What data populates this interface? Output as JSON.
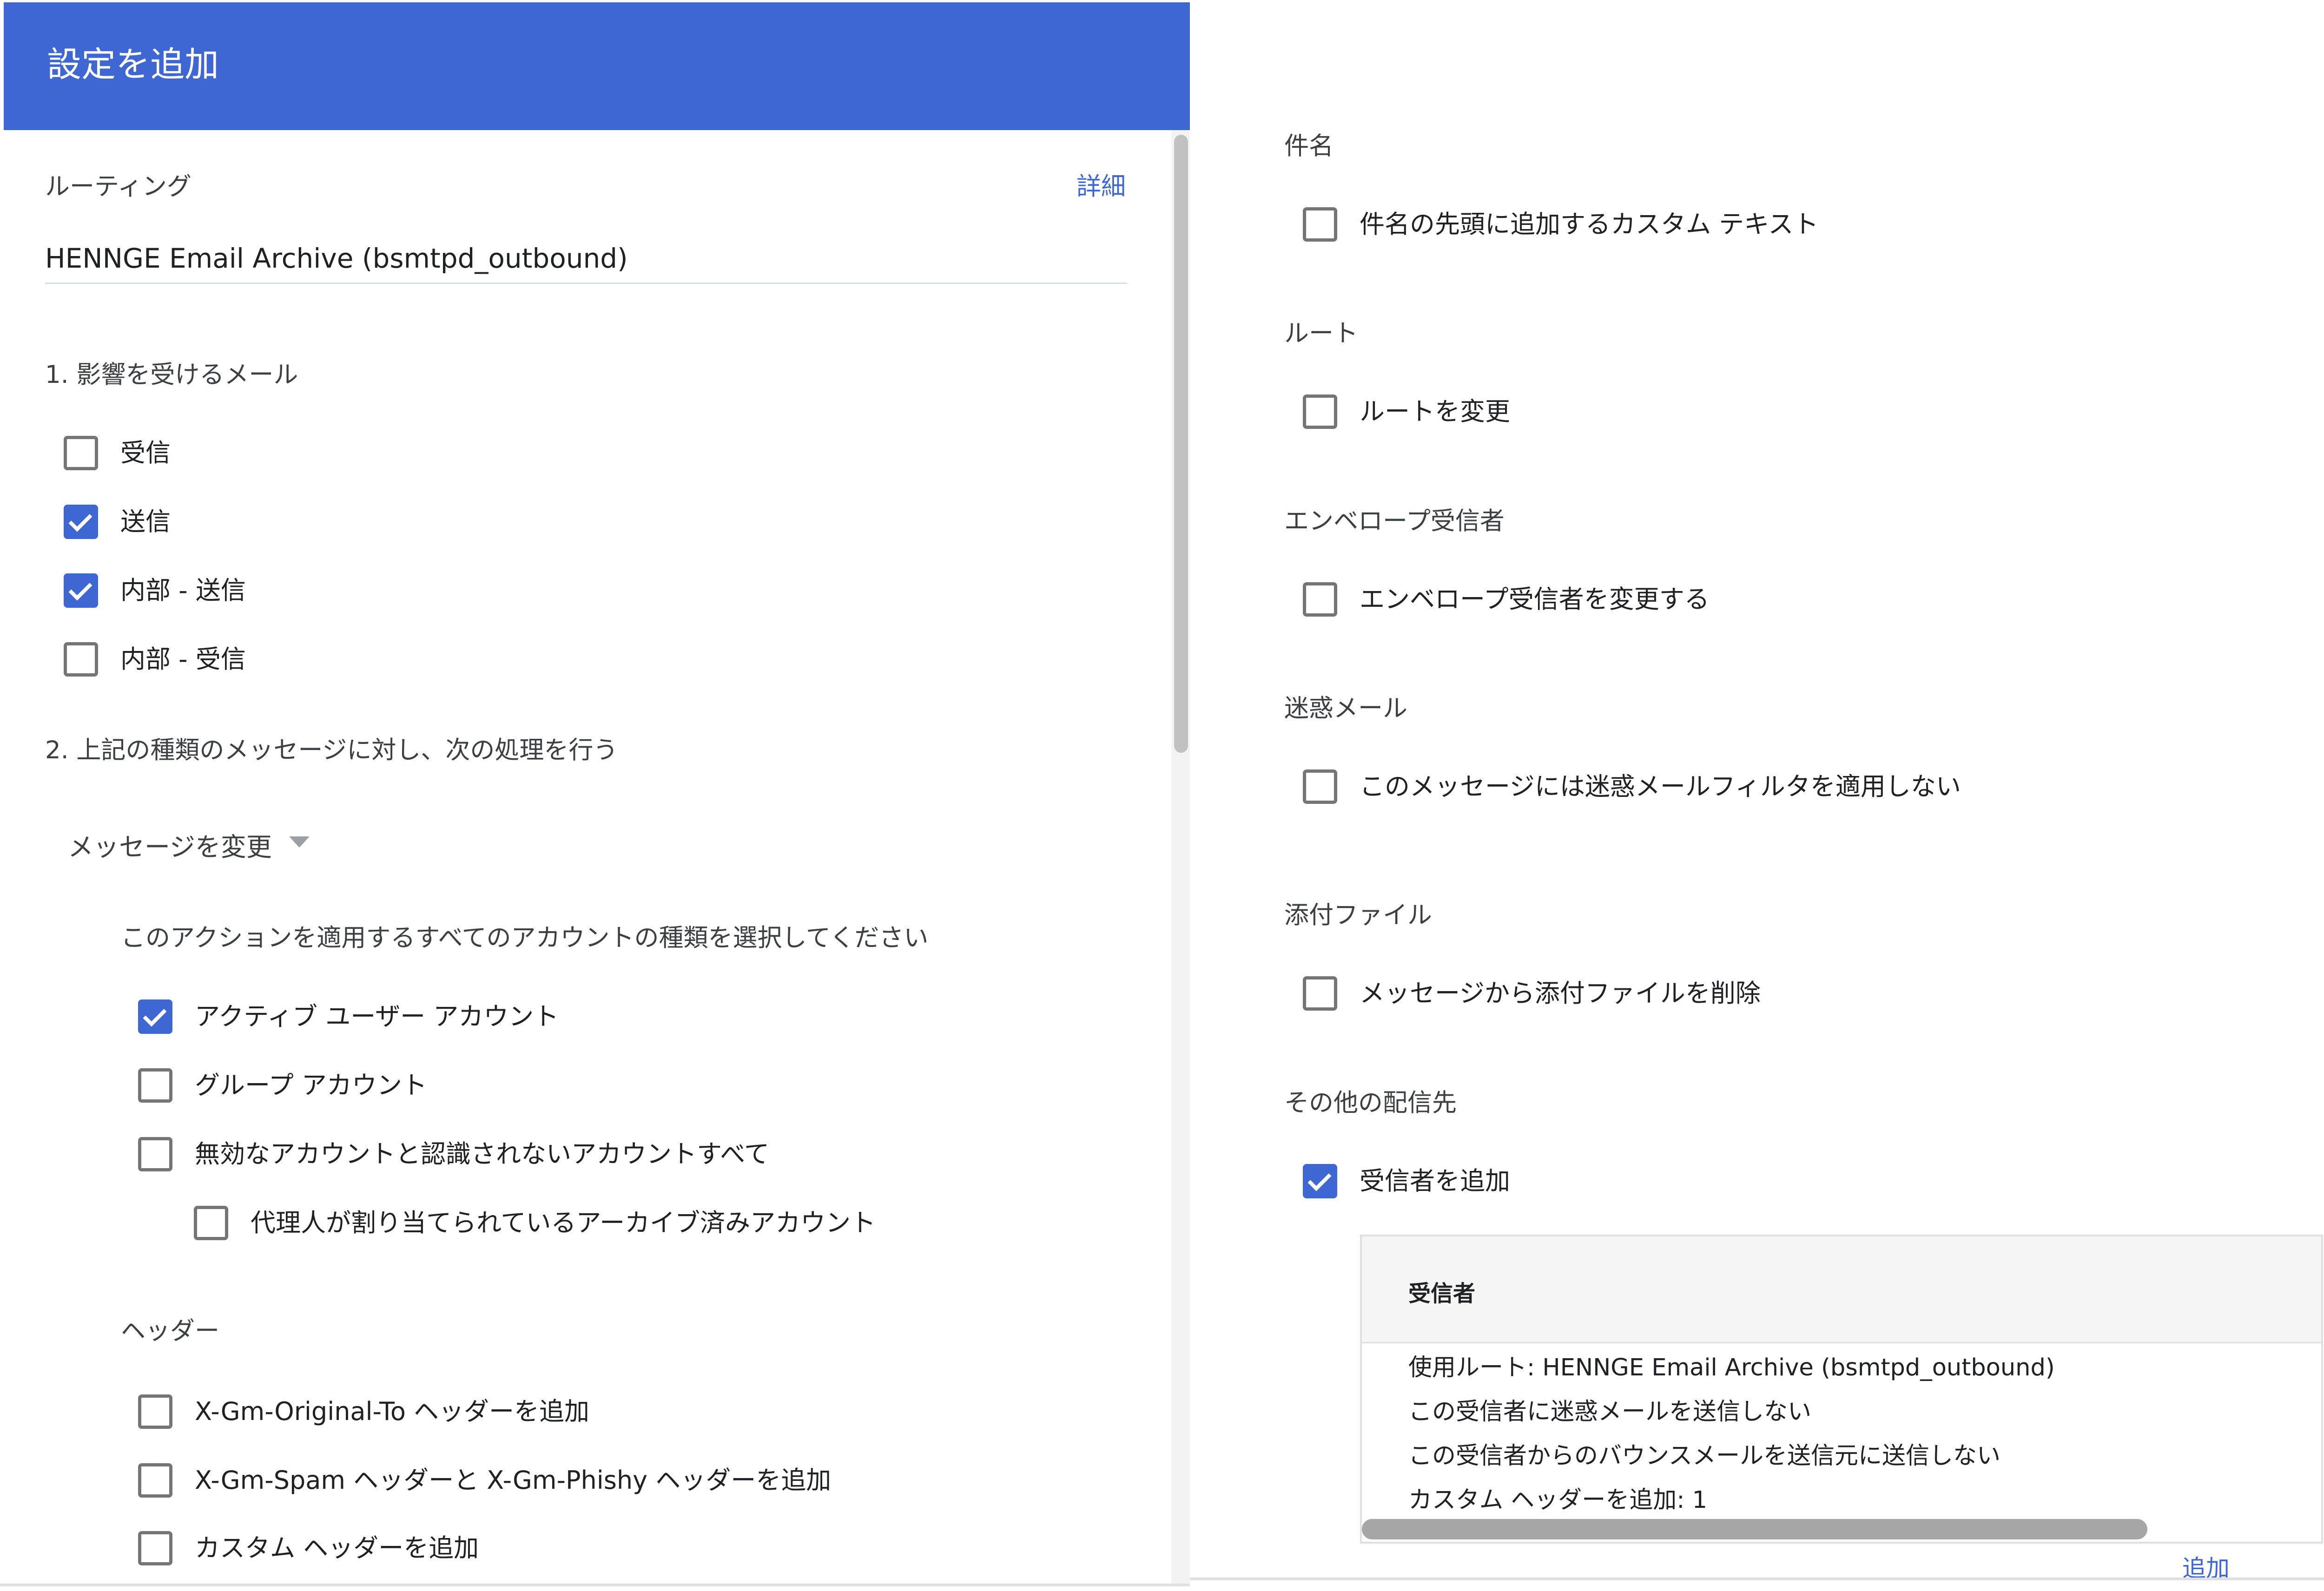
{
  "dialog": {
    "title": "設定を追加"
  },
  "routing": {
    "label": "ルーティング",
    "details_link": "詳細",
    "value": "HENNGE Email Archive (bsmtpd_outbound)"
  },
  "section1": {
    "heading": "1. 影響を受けるメール",
    "options": [
      {
        "label": "受信",
        "checked": false
      },
      {
        "label": "送信",
        "checked": true
      },
      {
        "label": "内部 - 送信",
        "checked": true
      },
      {
        "label": "内部 - 受信",
        "checked": false
      }
    ]
  },
  "section2": {
    "heading": "2. 上記の種類のメッセージに対し、次の処理を行う",
    "action_dropdown": "メッセージを変更",
    "account_types_prompt": "このアクションを適用するすべてのアカウントの種類を選択してください",
    "account_types": [
      {
        "label": "アクティブ ユーザー アカウント",
        "checked": true
      },
      {
        "label": "グループ アカウント",
        "checked": false
      },
      {
        "label": "無効なアカウントと認識されないアカウントすべて",
        "checked": false
      },
      {
        "label": "代理人が割り当てられているアーカイブ済みアカウント",
        "checked": false
      }
    ],
    "headers_heading": "ヘッダー",
    "headers_options": [
      {
        "label": "X-Gm-Original-To ヘッダーを追加",
        "checked": false
      },
      {
        "label": "X-Gm-Spam ヘッダーと X-Gm-Phishy ヘッダーを追加",
        "checked": false
      },
      {
        "label": "カスタム ヘッダーを追加",
        "checked": false
      }
    ]
  },
  "right": {
    "subject": {
      "heading": "件名",
      "option": "件名の先頭に追加するカスタム テキスト",
      "checked": false
    },
    "route": {
      "heading": "ルート",
      "option": "ルートを変更",
      "checked": false
    },
    "envelope": {
      "heading": "エンベロープ受信者",
      "option": "エンベロープ受信者を変更する",
      "checked": false
    },
    "spam": {
      "heading": "迷惑メール",
      "option": "このメッセージには迷惑メールフィルタを適用しない",
      "checked": false
    },
    "attachments": {
      "heading": "添付ファイル",
      "option": "メッセージから添付ファイルを削除",
      "checked": false
    },
    "other_destinations": {
      "heading": "その他の配信先",
      "option": "受信者を追加",
      "checked": true
    },
    "recipients_table": {
      "header": "受信者",
      "lines": [
        "使用ルート: HENNGE Email Archive (bsmtpd_outbound)",
        "この受信者に迷惑メールを送信しない",
        "この受信者からのバウンスメールを送信元に送信しない",
        "カスタム ヘッダーを追加: 1"
      ]
    },
    "add_link_partial": "追加"
  },
  "colors": {
    "accent": "#3f67d4",
    "checkbox_checked": "#3f67d4",
    "checkbox_unchecked_border": "#757575"
  },
  "icons": {
    "checkbox_checked": "check-icon",
    "dropdown": "caret-down-icon"
  }
}
